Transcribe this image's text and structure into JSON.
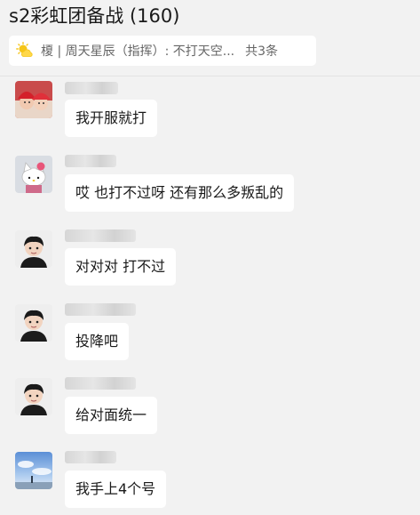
{
  "header": {
    "title": "s2彩虹团备战 (160)"
  },
  "pinned": {
    "icon": "sun-cloud-icon",
    "summary": "榎 | 周天星辰（指挥）: 不打天空...",
    "count": "共3条"
  },
  "messages": [
    {
      "sender": "",
      "avatar": "avatar-red-hat-kids",
      "text": "我开服就打"
    },
    {
      "sender": "",
      "avatar": "avatar-hello-kitty",
      "text": "哎 也打不过呀 还有那么多叛乱的"
    },
    {
      "sender": "",
      "avatar": "avatar-boy-black-shirt",
      "text": "对对对 打不过"
    },
    {
      "sender": "",
      "avatar": "avatar-boy-black-shirt",
      "text": "投降吧"
    },
    {
      "sender": "",
      "avatar": "avatar-boy-black-shirt",
      "text": "给对面统一"
    },
    {
      "sender": "",
      "avatar": "avatar-sky-scene",
      "text": "我手上4个号"
    }
  ],
  "colors": {
    "background": "#f2f2f2",
    "bubble": "#ffffff",
    "pinned_icon": "#f5c518"
  }
}
